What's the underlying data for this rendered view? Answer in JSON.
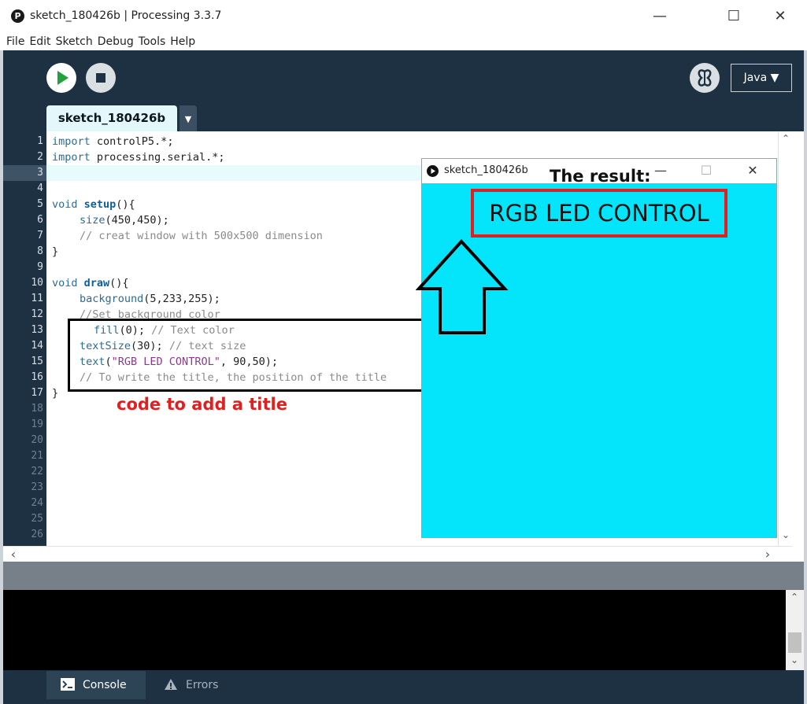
{
  "window": {
    "app_icon": "P",
    "title": "sketch_180426b | Processing 3.3.7",
    "minimize": "—",
    "maximize": "☐",
    "close": "✕"
  },
  "menu": [
    "File",
    "Edit",
    "Sketch",
    "Debug",
    "Tools",
    "Help"
  ],
  "toolbar": {
    "run_icon": "play-icon",
    "stop_icon": "stop-icon",
    "debug_icon": "butterfly-icon",
    "mode": "Java ▼"
  },
  "tabs": {
    "active": "sketch_180426b",
    "menu_arrow": "▼"
  },
  "editor": {
    "line_numbers": [
      "1",
      "2",
      "3",
      "4",
      "5",
      "6",
      "7",
      "8",
      "9",
      "10",
      "11",
      "12",
      "13",
      "14",
      "15",
      "16",
      "17",
      "18",
      "19",
      "20",
      "21",
      "22",
      "23",
      "24",
      "25",
      "26"
    ],
    "code": {
      "l1_kw": "import",
      "l1_rest": " controlP5.*;",
      "l2_kw": "import",
      "l2_rest": " processing.serial.*;",
      "l5_kw": "void",
      "l5_fn": "setup",
      "l5_rest": "(){",
      "l6_fn": "size",
      "l6_rest": "(450,450);",
      "l7": "// creat window with 500x500 dimension",
      "l8": "}",
      "l10_kw": "void",
      "l10_fn": "draw",
      "l10_rest": "(){",
      "l11_fn": "background",
      "l11_rest": "(5,233,255);",
      "l12": "//Set background color",
      "l13_fn": "fill",
      "l13_rest": "(0); ",
      "l13_cm": "// Text color",
      "l14_fn": "textSize",
      "l14_rest": "(30); ",
      "l14_cm": "// text size",
      "l15_fn": "text",
      "l15_open": "(",
      "l15_str": "\"RGB LED CONTROL\"",
      "l15_rest": ", 90,50);",
      "l16": "// To write the title, the position of the title",
      "l17": "}"
    }
  },
  "annotations": {
    "code_label": "code to add a title",
    "result_label": "The result:"
  },
  "sketch_window": {
    "title": "sketch_180426b",
    "minimize": "—",
    "maximize": "☐",
    "close": "✕",
    "rendered_text": "RGB LED CONTROL",
    "background": "#04e5fb"
  },
  "scroll": {
    "up": "⌃",
    "down": "⌄",
    "left": "‹",
    "right": "›"
  },
  "bottom_tabs": {
    "console": "Console",
    "errors": "Errors"
  },
  "colors": {
    "toolbar_bg": "#1e3142",
    "editor_bg": "#ffffff",
    "annotation_red": "#e02020",
    "sketch_bg": "#04e5fb"
  }
}
